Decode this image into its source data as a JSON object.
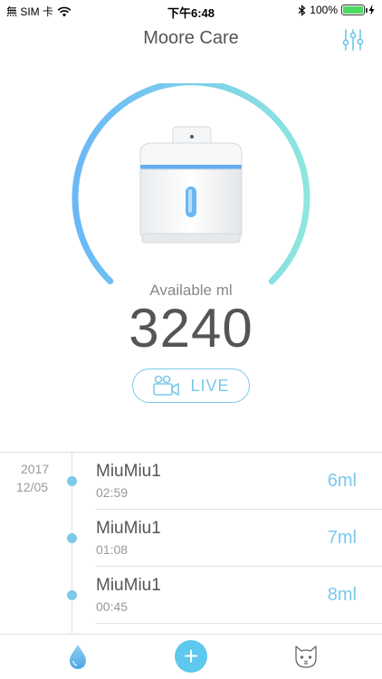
{
  "status_bar": {
    "carrier": "無 SIM 卡",
    "time": "下午6:48",
    "battery_percent": "100%",
    "battery_level": 1.0
  },
  "header": {
    "title": "Moore Care",
    "settings_icon": "sliders-icon"
  },
  "gauge": {
    "label": "Available ml",
    "value": "3240",
    "gradient_start": "#6ab8f7",
    "gradient_end": "#8ee6de"
  },
  "live_button": {
    "label": "LIVE",
    "icon": "video-camera-icon"
  },
  "timeline": {
    "date_year": "2017",
    "date_day": "12/05",
    "entries": [
      {
        "name": "MiuMiu1",
        "time": "02:59",
        "amount": "6ml"
      },
      {
        "name": "MiuMiu1",
        "time": "01:08",
        "amount": "7ml"
      },
      {
        "name": "MiuMiu1",
        "time": "00:45",
        "amount": "8ml"
      }
    ]
  },
  "tab_bar": {
    "tabs": [
      {
        "icon": "water-drop-icon"
      },
      {
        "icon": "add-icon",
        "label": "+"
      },
      {
        "icon": "cat-icon"
      }
    ]
  },
  "colors": {
    "accent": "#7cc9ea",
    "add_button": "#5ec8ee"
  }
}
